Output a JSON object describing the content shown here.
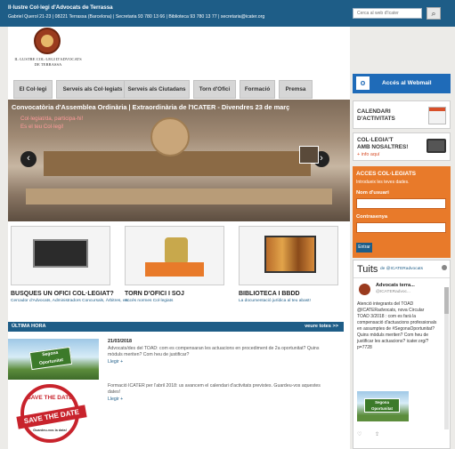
{
  "header": {
    "org": "Il·lustre Col·legi d'Advocats de Terrassa",
    "address": "Gabriel Querol 21-23 | 08221 Terrassa (Barcelona) | Secretaria 93 780 13 66 | Biblioteca 93 780 13 77 | secretaria@icater.org",
    "search_placeholder": "Cerca al web d'Icater",
    "search_icon": "magnifier-icon"
  },
  "logo": {
    "line1": "IL·LUSTRE COL·LEGI D'ADVOCATS",
    "line2": "DE TERRASSA"
  },
  "nav": {
    "tabs": [
      "El Col·legi",
      "Serveis als Col·legiats",
      "Serveis als Ciutadans",
      "Torn d'Ofici",
      "Formació",
      "Premsa"
    ]
  },
  "slider": {
    "title": "Convocatòria d'Assemblea Ordinària | Extraordinària de l'ICATER - Divendres 23 de març",
    "sub1": "Col·legiat/da, participa-hi!",
    "sub2": "Es el teu Col·legi!"
  },
  "cards": [
    {
      "title": "BUSQUES UN OFICI COL·LEGIAT?",
      "sub": "Cercador d'Advocats, Administradors Concursals, Àrbitres, etc."
    },
    {
      "title": "TORN D'OFICI I SOJ",
      "sub": "Accés normes Col·legiats"
    },
    {
      "title": "BIBLIOTECA I BBDD",
      "sub": "La documentació jurídica al teu abast!"
    }
  ],
  "ultima_hora": {
    "title": "ÚLTIMA HORA",
    "all": "veure totes >>",
    "items": [
      {
        "date": "21/03/2018",
        "text": "Advocats/des del TOAD: com es compensaran les actuacions en procediment de 2a oportunitat? Quins mòduls meriten? Com heu de justificar?",
        "more": "Llegir +"
      },
      {
        "date": "",
        "text": "Formació ICATER per l'abril 2018: us avancem el calendari d'activitats previstes. Guardeu-vos aquestes dates!",
        "more": "Llegir +"
      }
    ]
  },
  "sidebar": {
    "webmail": "Accés al Webmail",
    "calendar": "CALENDARI D'ACTIVITATS",
    "join_line1": "COL·LEGIA'T",
    "join_line2": "AMB NOSALTRES!",
    "join_more": "+ info aquí",
    "login": {
      "title": "ACCES COL·LEGIATS",
      "sub": "Introdueix les teves dades.",
      "user_label": "Nom d'usuari",
      "pass_label": "Contrasenya",
      "button": "Entrar"
    },
    "tweets": {
      "title": "Tuits",
      "by": "de @ICATERadvocats",
      "name": "Advocats terra...",
      "handle": "@ICATERadvoc...",
      "body": "Atenció integrants del TOAD @ICATERadvocats, nova Circular TOAD 3/2018 : com es farà la compensació d'actuacions professionals en assumptes de #SegonaOportunitat? Quins mòduls meriten? Com heu de justificar les actuacions? icater.org/?p=7728",
      "image_sign": "Segona Oportunitat"
    }
  },
  "news_images": {
    "sign": "Segona Oportunitat",
    "stamp_top": "SAVE THE DATE",
    "stamp_band": "SAVE THE DATE",
    "stamp_bottom": "Guardeu-vos la data!"
  }
}
